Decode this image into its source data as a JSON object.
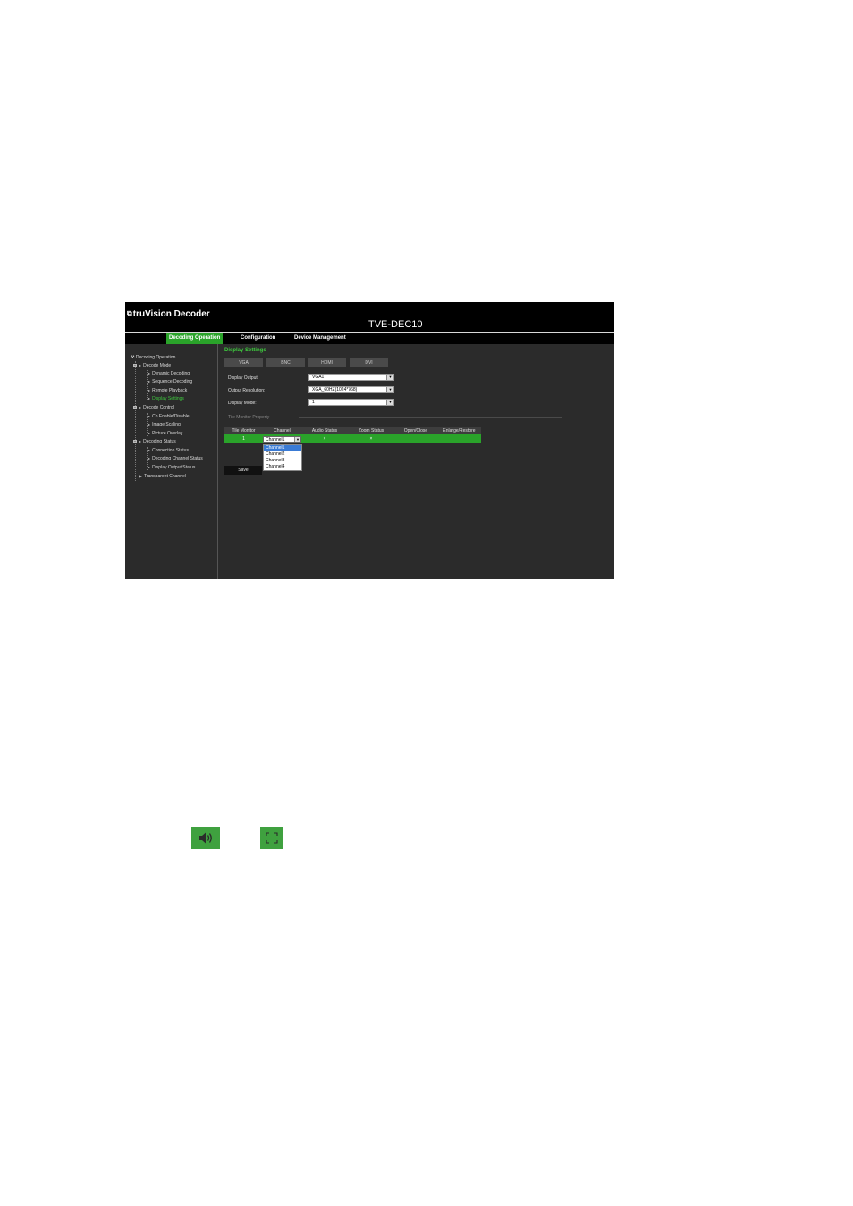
{
  "header": {
    "brand": "truVision Decoder",
    "model": "TVE-DEC10"
  },
  "nav": {
    "tabs": [
      {
        "label": "Decoding Operation",
        "active": true
      },
      {
        "label": "Configuration",
        "active": false
      },
      {
        "label": "Device Management",
        "active": false
      }
    ]
  },
  "sidebar": {
    "root": "Decoding Operation",
    "items": [
      {
        "label": "Decode Mode"
      },
      {
        "label": "Dynamic Decoding"
      },
      {
        "label": "Sequence Decoding"
      },
      {
        "label": "Remote Playback"
      },
      {
        "label": "Display Settings",
        "selected": true
      },
      {
        "label": "Decode Control"
      },
      {
        "label": "Ch Enable/Disable"
      },
      {
        "label": "Image Scaling"
      },
      {
        "label": "Picture Overlay"
      },
      {
        "label": "Decoding Status"
      },
      {
        "label": "Connection Status"
      },
      {
        "label": "Decoding Channel Status"
      },
      {
        "label": "Display Output Status"
      },
      {
        "label": "Transparent Channel"
      }
    ]
  },
  "main": {
    "title": "Display Settings",
    "tabs": [
      "VGA",
      "BNC",
      "HDMI",
      "DVI"
    ],
    "fields": [
      {
        "label": "Display Output:",
        "value": "VGA1"
      },
      {
        "label": "Output Resolution:",
        "value": "XGA_60HZ(1024*768)"
      },
      {
        "label": "Display Mode:",
        "value": "1"
      }
    ],
    "tile_monitor_property": "Tile Monitor Property",
    "table": {
      "headers": [
        "Tile Monitor",
        "Channel",
        "Audio Status",
        "Zoom Status",
        "Open/Close",
        "Enlarge/Restore"
      ],
      "row": {
        "tile_monitor": "1",
        "channel": "Channel1",
        "audio_status": "×",
        "zoom_status": "×"
      }
    },
    "channel_dropdown": {
      "options": [
        "Channel1",
        "Channel2",
        "Channel3",
        "Channel4"
      ],
      "highlighted": "Channel1"
    },
    "save_label": "Save"
  },
  "icons": {
    "audio": "speaker-icon",
    "zoom": "fullscreen-icon",
    "accent_color": "#3fa13f"
  }
}
